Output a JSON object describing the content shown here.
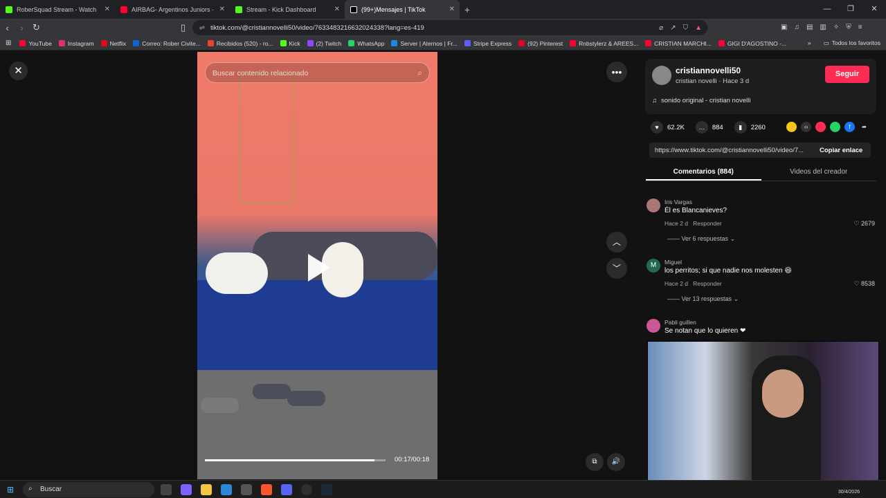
{
  "browser": {
    "tabs": [
      {
        "title": "RoberSquad Stream - Watch Live",
        "active": false,
        "favicon_color": "#53fc18"
      },
      {
        "title": "AIRBAG- Argentinos Juniors - EN VIVO",
        "active": false,
        "favicon_color": "#ff0033"
      },
      {
        "title": "Stream - Kick Dashboard",
        "active": false,
        "favicon_color": "#53fc18"
      },
      {
        "title": "(99+)Mensajes | TikTok",
        "active": true,
        "favicon_color": "#ffffff"
      }
    ],
    "url": "tiktok.com/@cristiannovelli50/video/7633483216632024338?lang=es-419",
    "bookmarks": [
      {
        "label": "YouTube",
        "color": "#ff0033"
      },
      {
        "label": "Instagram",
        "color": "#e1306c"
      },
      {
        "label": "Netflix",
        "color": "#e50914"
      },
      {
        "label": "Correo: Rober Civite...",
        "color": "#0a64d6"
      },
      {
        "label": "Recibidos (520) - ro...",
        "color": "#ea4335"
      },
      {
        "label": "Kick",
        "color": "#53fc18"
      },
      {
        "label": "(2) Twitch",
        "color": "#9146ff"
      },
      {
        "label": "WhatsApp",
        "color": "#25d366"
      },
      {
        "label": "Server | Aternos | Fr...",
        "color": "#1e88e5"
      },
      {
        "label": "Stripe Express",
        "color": "#635bff"
      },
      {
        "label": "(92) Pinterest",
        "color": "#e60023"
      },
      {
        "label": "Rnbstylerz & AREES...",
        "color": "#ff0033"
      },
      {
        "label": "CRISTIAN MARCHI...",
        "color": "#ff0033"
      },
      {
        "label": "GIGI D'AGOSTINO -...",
        "color": "#ff0033"
      }
    ],
    "other_bookmarks": "Todos los favoritos"
  },
  "video": {
    "search_placeholder": "Buscar contenido relacionado",
    "time": "00:17/00:18",
    "progress_fraction": 0.94
  },
  "post": {
    "username": "cristiannovelli50",
    "subtitle": "cristian novelli · Hace 3 d",
    "follow_label": "Seguir",
    "music": "sonido original - cristian novelli",
    "likes": "62.2K",
    "comments": "884",
    "saves": "2260",
    "link": "https://www.tiktok.com/@cristiannovelli50/video/7...",
    "copy_label": "Copiar enlace",
    "tab_comments": "Comentarios (884)",
    "tab_creator": "Videos del creador"
  },
  "comments": [
    {
      "name": "Iris Vargas",
      "text": "Él es Blancanieves?",
      "time": "Hace 2 d",
      "reply": "Responder",
      "likes": "2679",
      "replies": "Ver 6 respuestas",
      "avatar": ""
    },
    {
      "name": "Miguel",
      "text": "los perritos; si que nadie nos molesten 😆",
      "time": "Hace 2 d",
      "reply": "Responder",
      "likes": "8538",
      "replies": "Ver 13 respuestas",
      "avatar": "M"
    },
    {
      "name": "Pabli guillen",
      "text": "Se notan que lo quieren ❤",
      "avatar": ""
    }
  ],
  "taskbar": {
    "search_label": "Buscar",
    "date": "30/4/2026"
  }
}
